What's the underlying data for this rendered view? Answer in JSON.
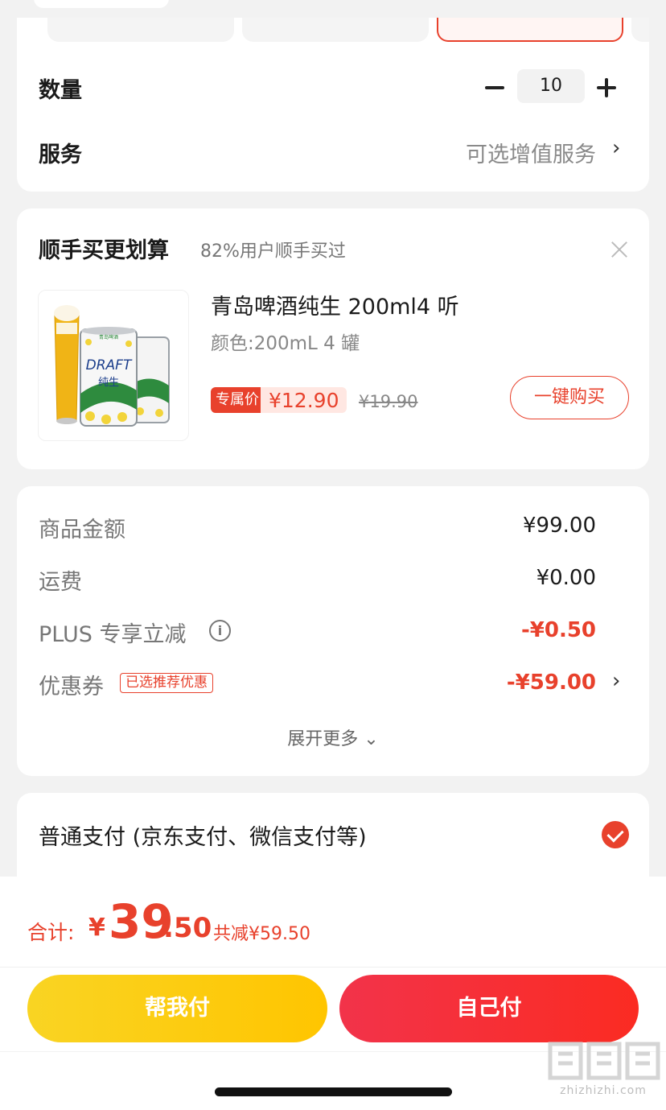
{
  "spec_card": {
    "quantity_label": "数量",
    "quantity_value": "10",
    "service_label": "服务",
    "service_hint": "可选增值服务",
    "chevron": "›"
  },
  "recommend": {
    "title": "顺手买更划算",
    "subtitle": "82%用户顺手买过",
    "product_name": "青岛啤酒纯生 200ml4 听",
    "product_spec": "颜色:200mL 4 罐",
    "badge": "专属价",
    "price": "¥12.90",
    "original_price": "¥19.90",
    "buy_button": "一键购买",
    "can_text": "DRAFT",
    "can_text2": "纯生",
    "can_brand": "青岛啤酒"
  },
  "fees": {
    "goods_label": "商品金额",
    "goods_value": "¥99.00",
    "shipping_label": "运费",
    "shipping_value": "¥0.00",
    "plus_label": "PLUS 专享立减",
    "plus_value": "-¥0.50",
    "coupon_label": "优惠券",
    "coupon_tag": "已选推荐优惠",
    "coupon_value": "-¥59.00",
    "expand": "展开更多 ⌄",
    "chevron": "›"
  },
  "payment": {
    "method": "普通支付 (京东支付、微信支付等)"
  },
  "bottom": {
    "total_label": "合计:",
    "currency": "¥",
    "total_int": "39",
    "total_dec": ".50",
    "total_saving": "共减¥59.50",
    "help_pay": "帮我付",
    "self_pay": "自己付",
    "watermark_text": "zhizhizhi.com"
  },
  "colors": {
    "accent": "#e8412c",
    "help_btn": "#f9d423",
    "self_btn": "#f2334a"
  }
}
